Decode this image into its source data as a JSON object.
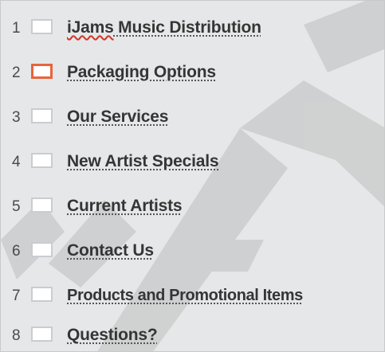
{
  "slides": [
    {
      "number": "1",
      "title_first": "iJams",
      "title_rest": " Music Distribution",
      "selected": false
    },
    {
      "number": "2",
      "title": "Packaging Options",
      "selected": true
    },
    {
      "number": "3",
      "title": "Our Services",
      "selected": false
    },
    {
      "number": "4",
      "title": "New Artist Specials",
      "selected": false
    },
    {
      "number": "5",
      "title": "Current Artists",
      "selected": false
    },
    {
      "number": "6",
      "title": "Contact Us",
      "selected": false
    },
    {
      "number": "7",
      "title": "Products and Promotional Items",
      "selected": false
    },
    {
      "number": "8",
      "title": "Questions?",
      "selected": false
    }
  ],
  "colors": {
    "background": "#e6e7e8",
    "selected_border": "#e8643c",
    "thumbnail_border": "#c9ccd0",
    "text": "#353535",
    "spellcheck_underline": "#d0382a",
    "watermark": "#cfd0d1"
  }
}
